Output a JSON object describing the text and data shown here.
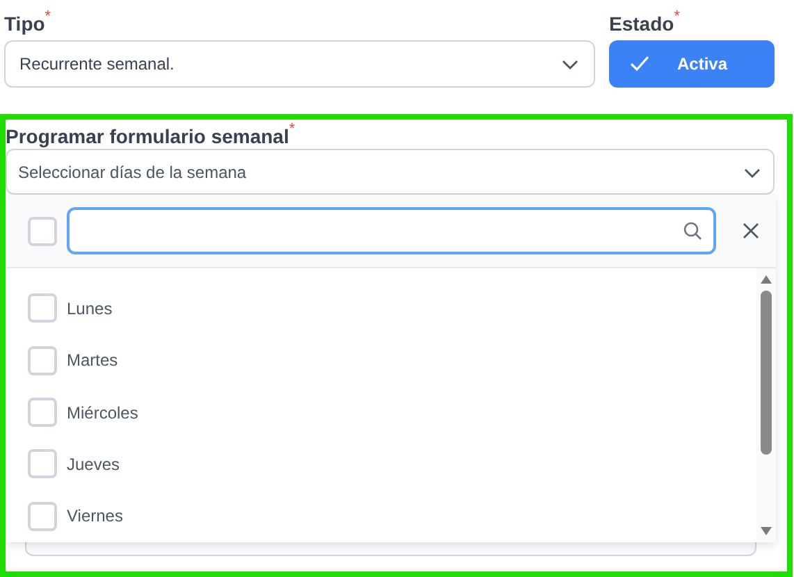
{
  "tipo": {
    "label": "Tipo",
    "required_mark": "*",
    "value": "Recurrente semanal."
  },
  "estado": {
    "label": "Estado",
    "required_mark": "*",
    "button": "Activa",
    "checked": true
  },
  "schedule": {
    "label": "Programar formulario semanal",
    "required_mark": "*",
    "placeholder": "Seleccionar días de la semana",
    "dropdown": {
      "select_all_checked": false,
      "options": [
        {
          "label": "Lunes",
          "checked": false
        },
        {
          "label": "Martes",
          "checked": false
        },
        {
          "label": "Miércoles",
          "checked": false
        },
        {
          "label": "Jueves",
          "checked": false
        },
        {
          "label": "Viernes",
          "checked": false
        }
      ]
    }
  }
}
